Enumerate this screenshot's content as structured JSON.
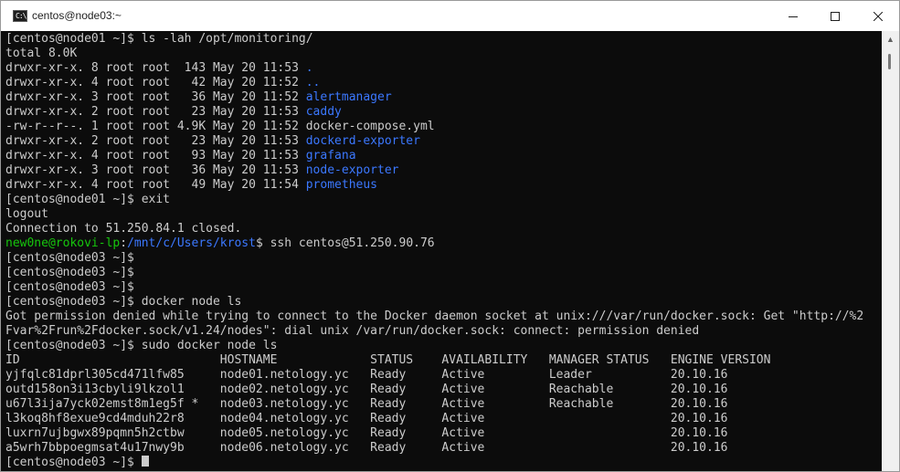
{
  "window": {
    "title": "centos@node03:~",
    "app_icon_text": "C:\\",
    "controls": {
      "minimize_icon": "minimize-icon",
      "maximize_icon": "maximize-icon",
      "close_icon": "close-icon"
    }
  },
  "colors": {
    "terminal_bg": "#0c0c0c",
    "text": "#cccccc",
    "dir_blue": "#3b78ff",
    "prompt_green": "#16c60c"
  },
  "terminal": {
    "lines": [
      [
        {
          "t": "[centos@node01 ~]$ ls -lah /opt/monitoring/"
        }
      ],
      [
        {
          "t": "total 8.0K"
        }
      ],
      [
        {
          "t": "drwxr-xr-x. 8 root root  143 May 20 11:53 "
        },
        {
          "t": ".",
          "c": "blue"
        }
      ],
      [
        {
          "t": "drwxr-xr-x. 4 root root   42 May 20 11:52 "
        },
        {
          "t": "..",
          "c": "blue"
        }
      ],
      [
        {
          "t": "drwxr-xr-x. 3 root root   36 May 20 11:52 "
        },
        {
          "t": "alertmanager",
          "c": "blue"
        }
      ],
      [
        {
          "t": "drwxr-xr-x. 2 root root   23 May 20 11:53 "
        },
        {
          "t": "caddy",
          "c": "blue"
        }
      ],
      [
        {
          "t": "-rw-r--r--. 1 root root 4.9K May 20 11:52 docker-compose.yml"
        }
      ],
      [
        {
          "t": "drwxr-xr-x. 2 root root   23 May 20 11:53 "
        },
        {
          "t": "dockerd-exporter",
          "c": "blue"
        }
      ],
      [
        {
          "t": "drwxr-xr-x. 4 root root   93 May 20 11:53 "
        },
        {
          "t": "grafana",
          "c": "blue"
        }
      ],
      [
        {
          "t": "drwxr-xr-x. 3 root root   36 May 20 11:53 "
        },
        {
          "t": "node-exporter",
          "c": "blue"
        }
      ],
      [
        {
          "t": "drwxr-xr-x. 4 root root   49 May 20 11:54 "
        },
        {
          "t": "prometheus",
          "c": "blue"
        }
      ],
      [
        {
          "t": "[centos@node01 ~]$ exit"
        }
      ],
      [
        {
          "t": "logout"
        }
      ],
      [
        {
          "t": "Connection to 51.250.84.1 closed."
        }
      ],
      [
        {
          "t": "new0ne@rokovi-lp",
          "c": "green"
        },
        {
          "t": ":"
        },
        {
          "t": "/mnt/c/Users/krost",
          "c": "blue"
        },
        {
          "t": "$ ssh centos@51.250.90.76"
        }
      ],
      [
        {
          "t": "[centos@node03 ~]$"
        }
      ],
      [
        {
          "t": "[centos@node03 ~]$"
        }
      ],
      [
        {
          "t": "[centos@node03 ~]$"
        }
      ],
      [
        {
          "t": "[centos@node03 ~]$ docker node ls"
        }
      ],
      [
        {
          "t": "Got permission denied while trying to connect to the Docker daemon socket at unix:///var/run/docker.sock: Get \"http://%2"
        }
      ],
      [
        {
          "t": "Fvar%2Frun%2Fdocker.sock/v1.24/nodes\": dial unix /var/run/docker.sock: connect: permission denied"
        }
      ],
      [
        {
          "t": "[centos@node03 ~]$ sudo docker node ls"
        }
      ],
      [
        {
          "t": "ID                            HOSTNAME             STATUS    AVAILABILITY   MANAGER STATUS   ENGINE VERSION"
        }
      ],
      [
        {
          "t": "yjfqlc81dprl305cd471lfw85     node01.netology.yc   Ready     Active         Leader           20.10.16"
        }
      ],
      [
        {
          "t": "outd158on3i13cbyli9lkzol1     node02.netology.yc   Ready     Active         Reachable        20.10.16"
        }
      ],
      [
        {
          "t": "u67l3ija7yck02emst8m1eg5f *   node03.netology.yc   Ready     Active         Reachable        20.10.16"
        }
      ],
      [
        {
          "t": "l3koq8hf8exue9cd4mduh22r8     node04.netology.yc   Ready     Active                          20.10.16"
        }
      ],
      [
        {
          "t": "luxrn7ujbgwx89pqmn5h2ctbw     node05.netology.yc   Ready     Active                          20.10.16"
        }
      ],
      [
        {
          "t": "a5wrh7bbpoegmsat4u17nwy9b     node06.netology.yc   Ready     Active                          20.10.16"
        }
      ],
      [
        {
          "t": "[centos@node03 ~]$ "
        }
      ]
    ]
  }
}
